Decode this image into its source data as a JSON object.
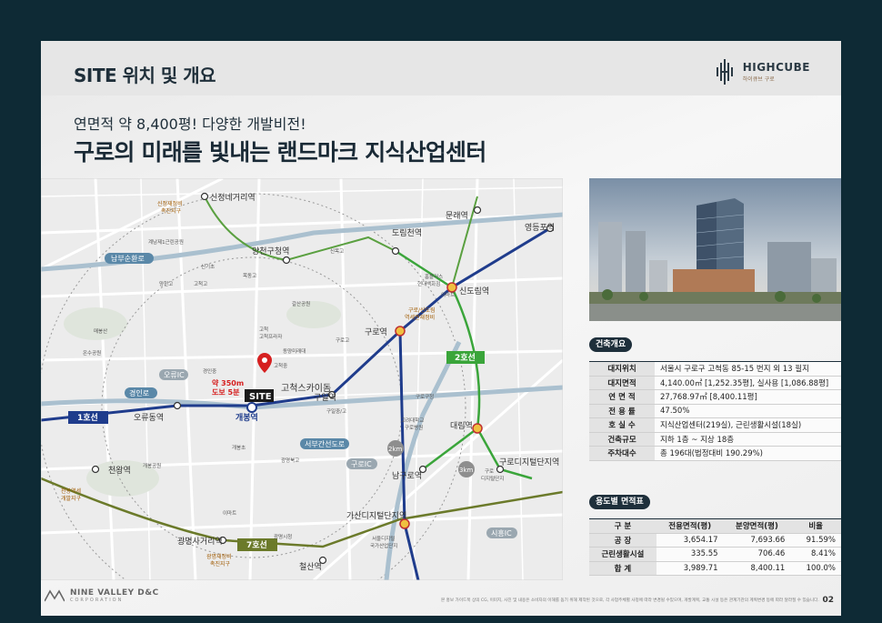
{
  "header": {
    "title": "SITE 위치 및 개요"
  },
  "logo": {
    "main": "HIGHCUBE",
    "sub": "하이큐브 구로"
  },
  "intro": {
    "subtitle": "연면적 약 8,400평! 다양한 개발비전!",
    "headline": "구로의 미래를 빛내는 랜드마크 지식산업센터"
  },
  "map": {
    "stations": {
      "sinjeongnegeori": "신정네거리역",
      "mullae": "문래역",
      "yeongdeungpo": "영등포역",
      "dorimcheon": "도림천역",
      "yangcheongucheong": "양천구청역",
      "sindorim": "신도림역",
      "guro": "구로역",
      "guil": "구일역",
      "gaebong": "개봉역",
      "oryudong": "오류동역",
      "daerim": "대림역",
      "gurodigital": "구로디지털단지역",
      "namguro": "남구로역",
      "gasan": "가산디지털단지역",
      "cheonwang": "천왕역",
      "gwangmyeongsageori": "광명사거리역",
      "cheolsan": "철산역",
      "gochuk_skydome": "고척스카이돔"
    },
    "road_badges": {
      "nambusunhwan": "남부순환로",
      "oryu_ic": "오류IC",
      "gyeongin": "경인로",
      "seobu_ganseon": "서부간선도로",
      "guro_ic": "구로IC",
      "siheung_ic": "시흥IC"
    },
    "line_badges": {
      "line1": "1호선",
      "line2": "2호선",
      "line7": "7호선"
    },
    "radius": {
      "r2": "2km",
      "r3": "3km"
    },
    "site": {
      "label": "SITE",
      "walk": "약 350m",
      "walk2": "도보 5분"
    },
    "districts": {
      "sinjeong": "신정재정비",
      "sinjeong2": "촉진지구",
      "gurosindorim": "구로/신도림",
      "gurosindorim2": "역세권재정비",
      "cheonwangdev": "천왕역세",
      "cheonwangdev2": "개발지구",
      "gwangmyeong": "광명재정비",
      "gwangmyeong2": "촉진지구"
    },
    "places": {
      "gyenamjae1": "계남제1근린공원",
      "sinkiso": "신기초",
      "mokdong": "목동고",
      "yangcheon": "양천고",
      "gocheokgo": "고척고",
      "galsan": "갈산공원",
      "sinmok": "신목고",
      "maehwa": "매봉산",
      "onsu": "온수공원",
      "gaeungeom": "경인중",
      "gochukplaza": "고척프라자",
      "dongyang": "동양미래대",
      "gochukjung": "고척중",
      "gurogo": "구로고",
      "gurogucheong": "구로구청",
      "korea_univ": "고려대학교",
      "korea_univ2": "구로병원",
      "guiljunggo": "구일중/고",
      "gaebongcho": "개봉초",
      "gwangmyeonggo": "광명북고",
      "hyundai": "현대백화점",
      "hyundai_dept": "홈플러스",
      "emart": "이마트",
      "emart2": "이마트",
      "gaebongpark": "개봉공원",
      "gurodigitalcomplex": "구로",
      "gurodigitalcomplex2": "디지털단지",
      "gasannat": "서울디지털",
      "gasannat2": "국가산업단지",
      "gwangmyeongsi": "광명시청",
      "gochuk": "고척"
    }
  },
  "overview": {
    "label": "건축개요",
    "rows": [
      {
        "key": "대지위치",
        "value": "서울시 구로구 고척동 85-15 번지 외 13 필지"
      },
      {
        "key": "대지면적",
        "value": "4,140.00㎡ [1,252.35평], 실사용 [1,086.88평]"
      },
      {
        "key": "연 면 적",
        "value": "27,768.97㎡ [8,400.11평]"
      },
      {
        "key": "전 용 률",
        "value": "47.50%"
      },
      {
        "key": "호 실 수",
        "value": "지식산업센터(219실), 근린생활시설(18실)"
      },
      {
        "key": "건축규모",
        "value": "지하 1층 ~ 지상 18층"
      },
      {
        "key": "주차대수",
        "value": "총 196대(법정대비 190.29%)"
      }
    ]
  },
  "usage": {
    "label": "용도별 면적표",
    "headers": [
      "구 분",
      "전용면적(평)",
      "분양면적(평)",
      "비율"
    ],
    "rows": [
      [
        "공 장",
        "3,654.17",
        "7,693.66",
        "91.59%"
      ],
      [
        "근린생활시설",
        "335.55",
        "706.46",
        "8.41%"
      ],
      [
        "합 계",
        "3,989.71",
        "8,400.11",
        "100.0%"
      ]
    ]
  },
  "footer": {
    "brand": "NINE VALLEY D&C",
    "brand_sub": "CORPORATION",
    "disclaimer": "본 홍보 가이드북 상의 CG, 이미지, 사진 및 내용은 소비자의 이해를 돕기 위해 제작된 것으로, 각 사업주체별 사정에 따라 변경될 수있으며, 개발계획, 교통 시설 등은 관계기관의 계획변경 등에 따라 달라질 수 있습니다.",
    "page": "02"
  },
  "colors": {
    "navy": "#1e2f3b",
    "line1": "#1f3c8c",
    "line2": "#3aa53a",
    "line7": "#6b7a2a",
    "line_green": "#5aa040",
    "site_red": "#d62020",
    "road": "#5a88a8"
  }
}
